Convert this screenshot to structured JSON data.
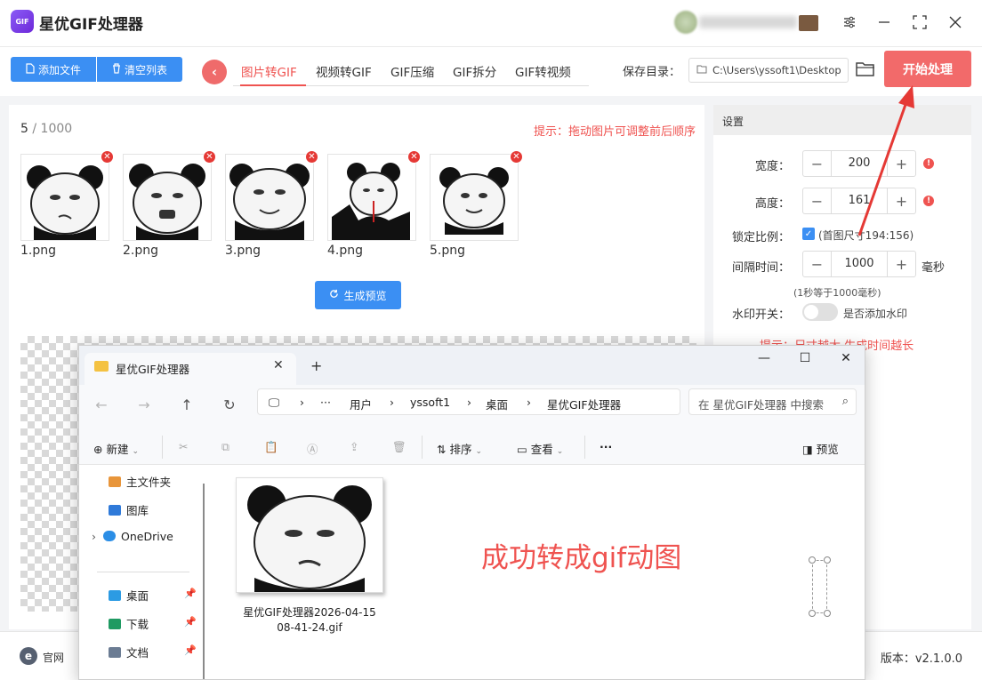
{
  "app": {
    "title": "星优GIF处理器",
    "logo_text": "GIF"
  },
  "window_controls": {
    "settings": "≡",
    "minimize": "—",
    "maximize": "⛶",
    "close": "✕"
  },
  "toolbar": {
    "add_files": "添加文件",
    "clear_list": "清空列表",
    "tabs": [
      "图片转GIF",
      "视频转GIF",
      "GIF压缩",
      "GIF拆分",
      "GIF转视频"
    ],
    "active_tab": 0,
    "save_dir_label": "保存目录：",
    "save_dir_value": "C:\\Users\\yssoft1\\Desktop",
    "start_button": "开始处理"
  },
  "image_list": {
    "count": "5",
    "max": "1000",
    "hint": "提示：拖动图片可调整前后顺序",
    "files": [
      "1.png",
      "2.png",
      "3.png",
      "4.png",
      "5.png"
    ],
    "preview_button": "生成预览"
  },
  "settings": {
    "header": "设置",
    "width_label": "宽度：",
    "width_value": "200",
    "height_label": "高度：",
    "height_value": "161",
    "lock_label": "锁定比例：",
    "lock_checked": true,
    "lock_note": "(首图尺寸194:156)",
    "interval_label": "间隔时间：",
    "interval_value": "1000",
    "interval_unit": "毫秒",
    "interval_note": "(1秒等于1000毫秒)",
    "watermark_label": "水印开关：",
    "watermark_toggle_text": "是否添加水印",
    "watermark_on": false,
    "hint": "提示：尺寸越大,生成时间越长"
  },
  "statusbar": {
    "site": "官网",
    "version": "版本：v2.1.0.0"
  },
  "explorer": {
    "tab_title": "星优GIF处理器",
    "new_tab": "+",
    "breadcrumbs": [
      "用户",
      "yssoft1",
      "桌面",
      "星优GIF处理器"
    ],
    "search_placeholder": "在 星优GIF处理器 中搜索",
    "commands": {
      "new": "新建",
      "sort": "排序",
      "view": "查看",
      "more": "···",
      "preview": "预览"
    },
    "sidebar": [
      {
        "label": "主文件夹",
        "icon": "home-icon",
        "pinned": false
      },
      {
        "label": "图库",
        "icon": "gallery-icon",
        "pinned": false
      },
      {
        "label": "OneDrive",
        "icon": "cloud-icon",
        "pinned": false
      },
      {
        "label": "桌面",
        "icon": "desktop-icon",
        "pinned": true
      },
      {
        "label": "下载",
        "icon": "download-icon",
        "pinned": true
      },
      {
        "label": "文档",
        "icon": "document-icon",
        "pinned": true
      }
    ],
    "file": {
      "name_line1": "星优GIF处理器2026-04-15",
      "name_line2": "08-41-24.gif"
    },
    "annotation": "成功转成gif动图"
  },
  "colors": {
    "accent_blue": "#3b8ff3",
    "accent_red": "#ef5350",
    "start_button": "#f26a6a"
  }
}
